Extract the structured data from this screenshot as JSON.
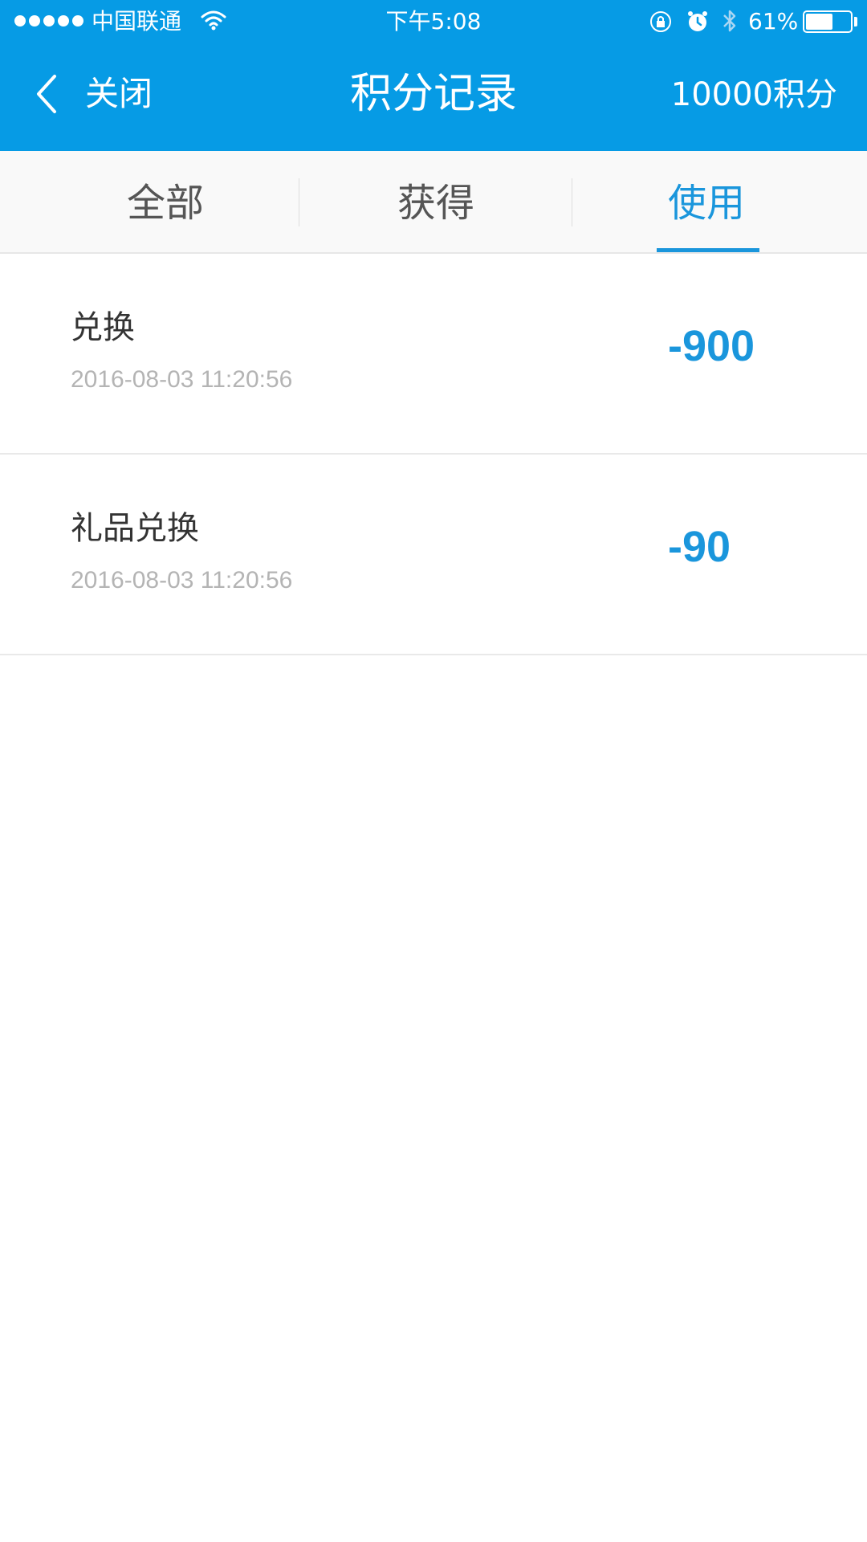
{
  "status_bar": {
    "carrier": "中国联通",
    "time": "下午5:08",
    "battery_percent": "61%",
    "battery_level": 0.61,
    "icons": [
      "signal-dots-icon",
      "wifi-icon",
      "rotation-lock-icon",
      "alarm-icon",
      "bluetooth-icon",
      "battery-icon"
    ]
  },
  "nav": {
    "back_label": "关闭",
    "back_icon": "chevron-left-icon",
    "title": "积分记录",
    "points_total": "10000积分"
  },
  "tabs": [
    {
      "label": "全部",
      "active": false
    },
    {
      "label": "获得",
      "active": false
    },
    {
      "label": "使用",
      "active": true
    }
  ],
  "records": [
    {
      "title": "兑换",
      "time": "2016-08-03 11:20:56",
      "amount": "-900"
    },
    {
      "title": "礼品兑换",
      "time": "2016-08-03 11:20:56",
      "amount": "-90"
    }
  ],
  "colors": {
    "header_bg": "#069be5",
    "accent": "#1a96dc",
    "tab_bg": "#f9f9f9",
    "secondary_text": "#b4b4b4"
  }
}
